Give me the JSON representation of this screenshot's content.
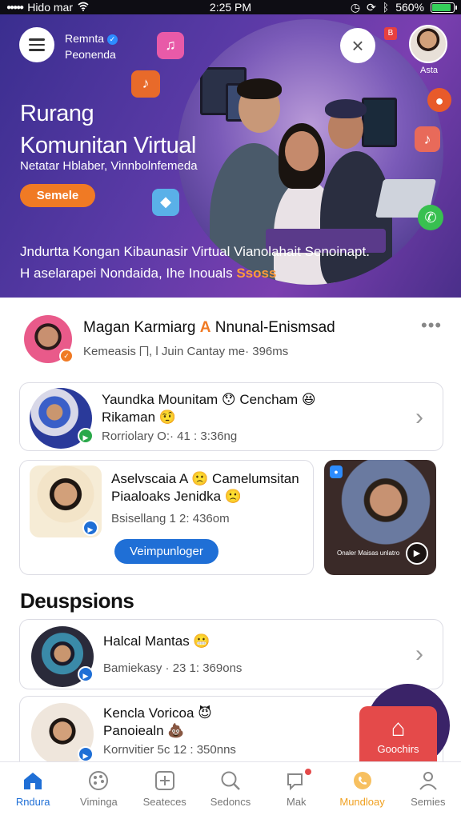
{
  "status_bar": {
    "carrier": "Hido mar",
    "time": "2:25 PM",
    "battery": "560%"
  },
  "hero": {
    "brand_line1": "Remnta",
    "brand_line2": "Peonenda",
    "top_avatar_label": "Asta",
    "title_line1": "Rurang",
    "title_line2": "Komunitan Virtual",
    "subtitle": "Netatar Hblaber, Vinnbolnfemeda",
    "cta_label": "Semele",
    "description_line1": "Jndurtta Kongan Kibaunasir Virtual Vianolahait Senoinapt.",
    "description_line2": "H aselarapei Nondaida, Ihe Inouals",
    "description_accent": "Ssoss"
  },
  "profile": {
    "name": "Magan Karmiarg",
    "name_suffix": "Nnunal-Enismsad",
    "meta": "Kemeasis ⨅, l Juin Cantay me· 396ms",
    "more": "•••"
  },
  "cards": [
    {
      "title_line1": "Yaundka Mounitam 😯 Cencham 😆",
      "title_line2": "Rikaman 🤨",
      "meta": "Rorriolary O:· 41 : 3:36ng"
    },
    {
      "title_line1": "Aselvscaia A 🙁 Camelumsitan",
      "title_line2": "Piaaloaks Jenidka 🙁",
      "meta": "Bsisellang 1 2: 436om",
      "button_label": "Veimpunloger"
    }
  ],
  "video": {
    "caption": "Onaler Maisas unlatro"
  },
  "section": {
    "title": "Deuspsions"
  },
  "list": [
    {
      "title_line1": "Halcal Mantas 😬",
      "title_line2": "",
      "meta": "Bamiekasy · 23 1: 369ons"
    },
    {
      "title_line1": "Kencla Voricoa 😈",
      "title_line2": "Panoiealn 💩",
      "meta": "Kornvitier 5c 12 : 350nns"
    }
  ],
  "fab": {
    "label": "Goochirs"
  },
  "nav": [
    {
      "label": "Rndura",
      "icon": "home-icon"
    },
    {
      "label": "Viminga",
      "icon": "palette-icon"
    },
    {
      "label": "Seateces",
      "icon": "plus-square-icon"
    },
    {
      "label": "Sedoncs",
      "icon": "search-icon"
    },
    {
      "label": "Mak",
      "icon": "chat-icon"
    },
    {
      "label": "Mundloay",
      "icon": "phone-icon"
    },
    {
      "label": "Semies",
      "icon": "person-icon"
    }
  ],
  "colors": {
    "accent_orange": "#f07a24",
    "primary_blue": "#1f6fd6",
    "fab_red": "#e44a4a",
    "hero_purple": "#5a3aa6"
  }
}
